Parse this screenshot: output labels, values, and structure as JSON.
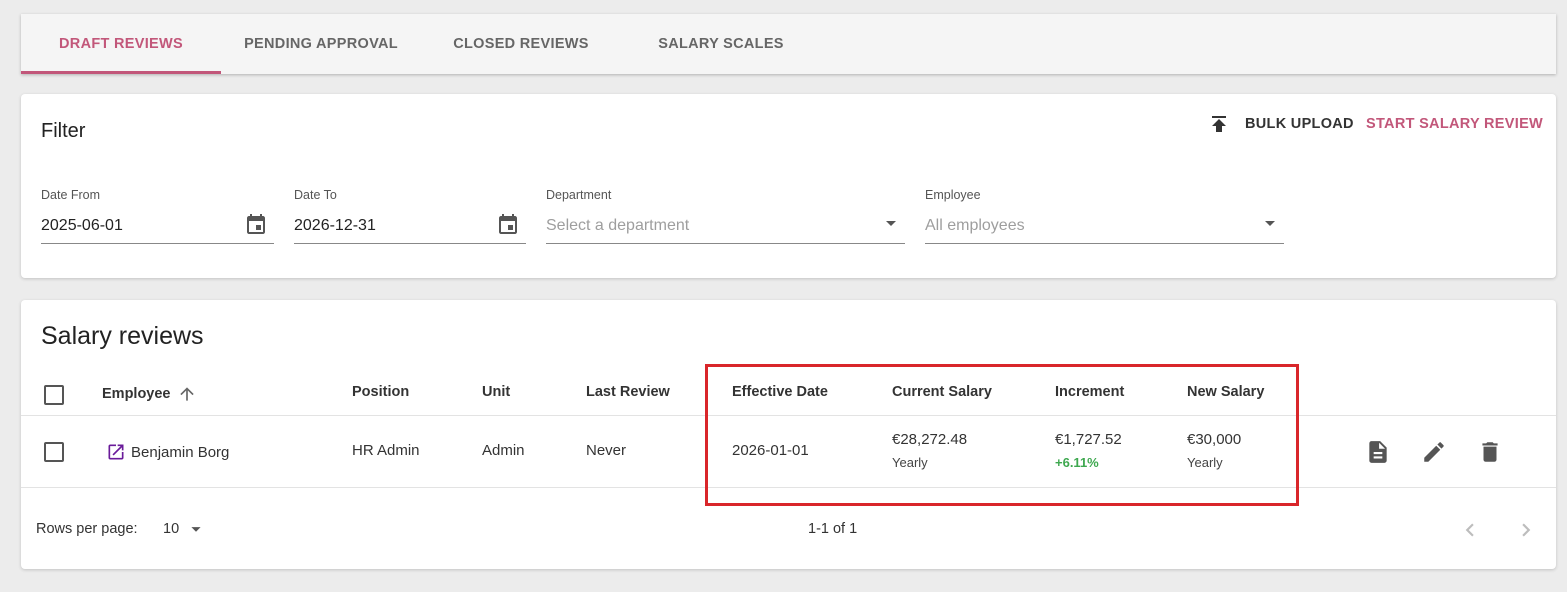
{
  "tabs": [
    {
      "label": "DRAFT REVIEWS",
      "active": true
    },
    {
      "label": "PENDING APPROVAL",
      "active": false
    },
    {
      "label": "CLOSED REVIEWS",
      "active": false
    },
    {
      "label": "SALARY SCALES",
      "active": false
    }
  ],
  "filter": {
    "title": "Filter",
    "bulk_upload_label": "BULK UPLOAD",
    "start_review_label": "START SALARY REVIEW",
    "date_from": {
      "label": "Date From",
      "value": "2025-06-01"
    },
    "date_to": {
      "label": "Date To",
      "value": "2026-12-31"
    },
    "department": {
      "label": "Department",
      "placeholder": "Select a department"
    },
    "employee": {
      "label": "Employee",
      "placeholder": "All employees"
    }
  },
  "reviews": {
    "title": "Salary reviews",
    "columns": {
      "employee": "Employee",
      "position": "Position",
      "unit": "Unit",
      "last_review": "Last Review",
      "effective_date": "Effective Date",
      "current_salary": "Current Salary",
      "increment": "Increment",
      "new_salary": "New Salary"
    },
    "rows": [
      {
        "employee": "Benjamin Borg",
        "position": "HR Admin",
        "unit": "Admin",
        "last_review": "Never",
        "effective_date": "2026-01-01",
        "current_salary": "€28,272.48",
        "current_salary_period": "Yearly",
        "increment": "€1,727.52",
        "increment_pct": "+6.11%",
        "new_salary": "€30,000",
        "new_salary_period": "Yearly"
      }
    ],
    "footer": {
      "rows_per_page_label": "Rows per page:",
      "rows_per_page_value": "10",
      "range": "1-1 of 1"
    }
  },
  "colors": {
    "accent": "#c2577a",
    "positive": "#3ea84f",
    "highlight": "#d9262a",
    "link_icon": "#6a1b9a"
  },
  "icons": [
    "upload-icon",
    "calendar-icon",
    "dropdown-arrow-icon",
    "sort-arrow-up-icon",
    "open-in-new-icon",
    "document-icon",
    "edit-icon",
    "delete-icon",
    "chevron-left-icon",
    "chevron-right-icon"
  ]
}
